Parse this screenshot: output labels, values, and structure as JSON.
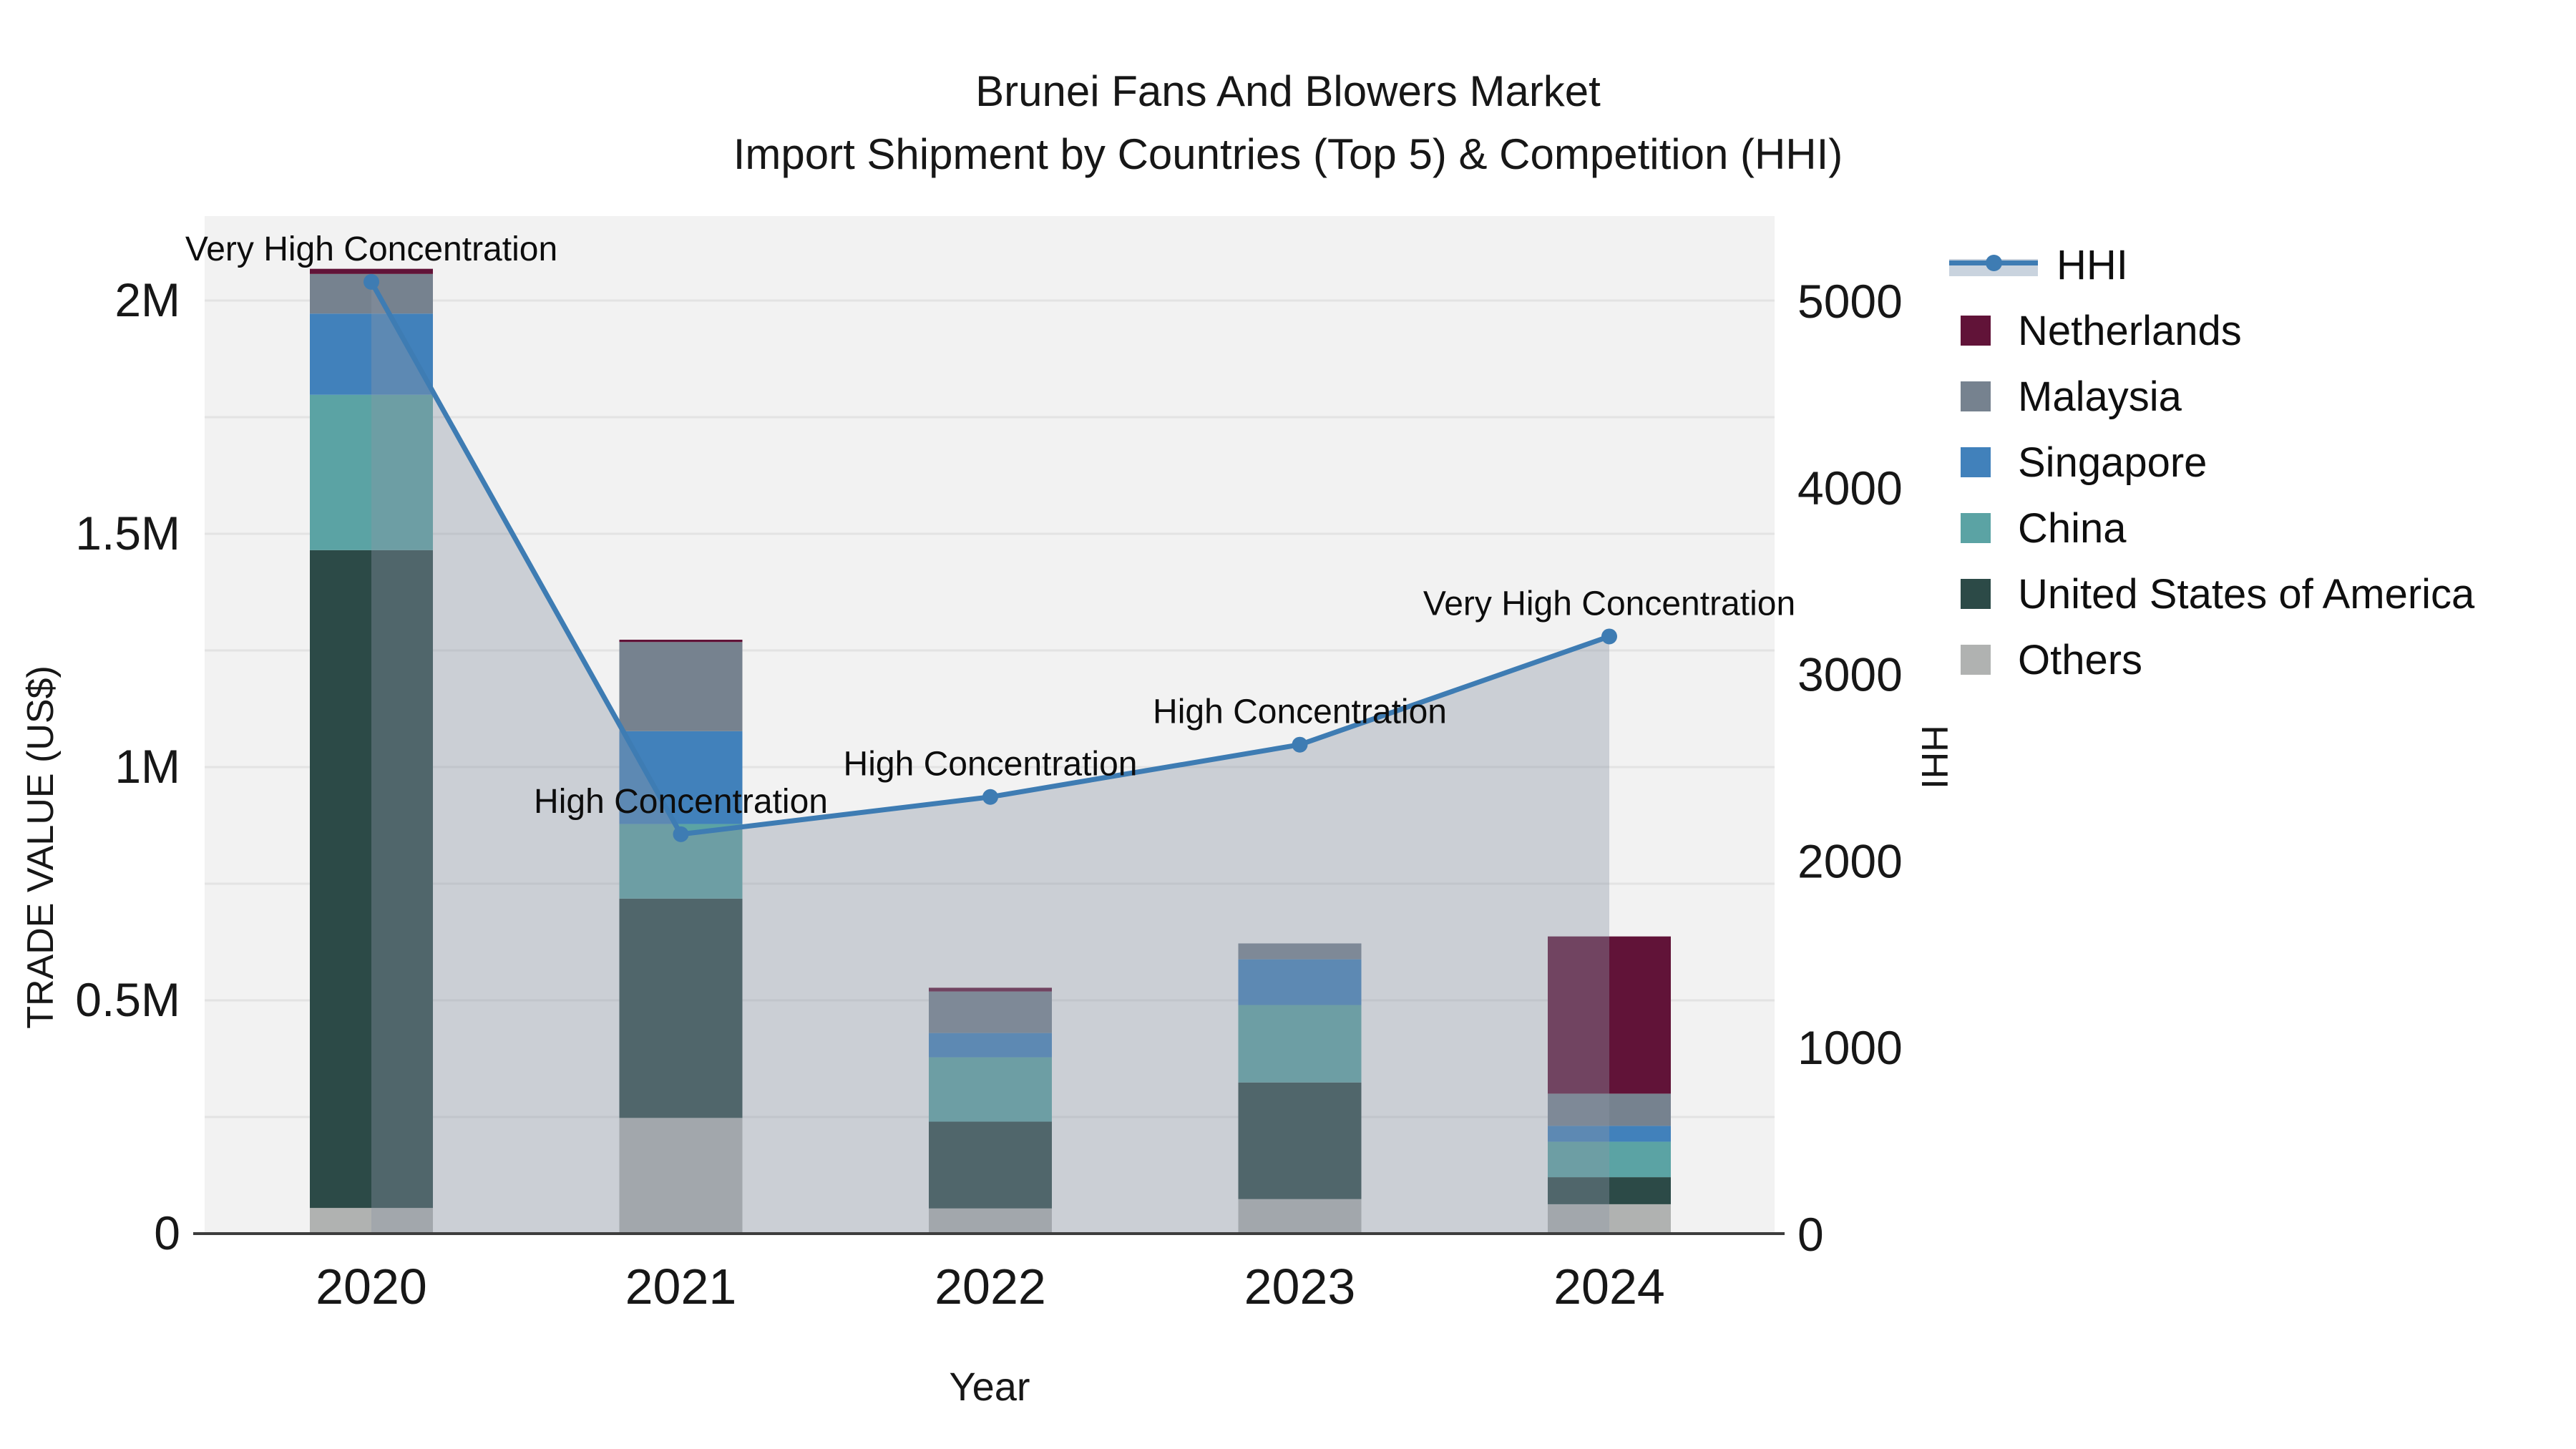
{
  "title": {
    "line1": "Brunei Fans And Blowers Market",
    "line2": "Import Shipment by Countries (Top 5) & Competition (HHI)"
  },
  "axes": {
    "y_left": {
      "title": "TRADE VALUE (US$)",
      "ticks": [
        {
          "v": 0,
          "label": "0"
        },
        {
          "v": 0.5,
          "label": "0.5M"
        },
        {
          "v": 1,
          "label": "1M"
        },
        {
          "v": 1.5,
          "label": "1.5M"
        },
        {
          "v": 2,
          "label": "2M"
        }
      ]
    },
    "y_right": {
      "title": "HHI",
      "ticks": [
        {
          "v": 0,
          "label": "0"
        },
        {
          "v": 1000,
          "label": "1000"
        },
        {
          "v": 2000,
          "label": "2000"
        },
        {
          "v": 3000,
          "label": "3000"
        },
        {
          "v": 4000,
          "label": "4000"
        },
        {
          "v": 5000,
          "label": "5000"
        }
      ]
    },
    "x": {
      "title": "Year"
    }
  },
  "legend": {
    "items": [
      {
        "label": "HHI",
        "type": "line",
        "color": "#3e7cb3",
        "band": "#c9d3de"
      },
      {
        "label": "Netherlands",
        "type": "square",
        "color": "#611338"
      },
      {
        "label": "Malaysia",
        "type": "square",
        "color": "#76828f"
      },
      {
        "label": "Singapore",
        "type": "square",
        "color": "#4181bb"
      },
      {
        "label": "China",
        "type": "square",
        "color": "#5ba3a4"
      },
      {
        "label": "United States of America",
        "type": "square",
        "color": "#2c4a47"
      },
      {
        "label": "Others",
        "type": "square",
        "color": "#b0b2b1"
      }
    ]
  },
  "chart_data": {
    "type": "combo-stacked-bar-line",
    "categories": [
      "2020",
      "2021",
      "2022",
      "2023",
      "2024"
    ],
    "unit_left": "US$ millions",
    "ylim_left": [
      0,
      2.2
    ],
    "ylim_right": [
      0,
      5500
    ],
    "grid": true,
    "legend_position": "right",
    "bar_series_bottom_to_top": [
      {
        "name": "Others",
        "color": "#b0b2b1",
        "values": [
          0.055,
          0.248,
          0.054,
          0.074,
          0.063
        ]
      },
      {
        "name": "United States of America",
        "color": "#2c4a47",
        "values": [
          1.41,
          0.47,
          0.186,
          0.25,
          0.058
        ]
      },
      {
        "name": "China",
        "color": "#5ba3a4",
        "values": [
          0.333,
          0.16,
          0.138,
          0.166,
          0.076
        ]
      },
      {
        "name": "Singapore",
        "color": "#4181bb",
        "values": [
          0.174,
          0.199,
          0.052,
          0.098,
          0.034
        ]
      },
      {
        "name": "Malaysia",
        "color": "#76828f",
        "values": [
          0.085,
          0.191,
          0.089,
          0.034,
          0.069
        ]
      },
      {
        "name": "Netherlands",
        "color": "#611338",
        "values": [
          0.011,
          0.005,
          0.008,
          0.0,
          0.337
        ]
      }
    ],
    "line_series": {
      "name": "HHI",
      "color": "#3e7cb3",
      "area_fill": "rgba(140,150,166,0.38)",
      "values": [
        5100,
        2140,
        2340,
        2620,
        3200
      ]
    },
    "annotations": [
      {
        "x": "2020",
        "text": "Very High Concentration"
      },
      {
        "x": "2021",
        "text": "High Concentration"
      },
      {
        "x": "2022",
        "text": "High Concentration"
      },
      {
        "x": "2023",
        "text": "High Concentration"
      },
      {
        "x": "2024",
        "text": "Very High Concentration"
      }
    ]
  }
}
